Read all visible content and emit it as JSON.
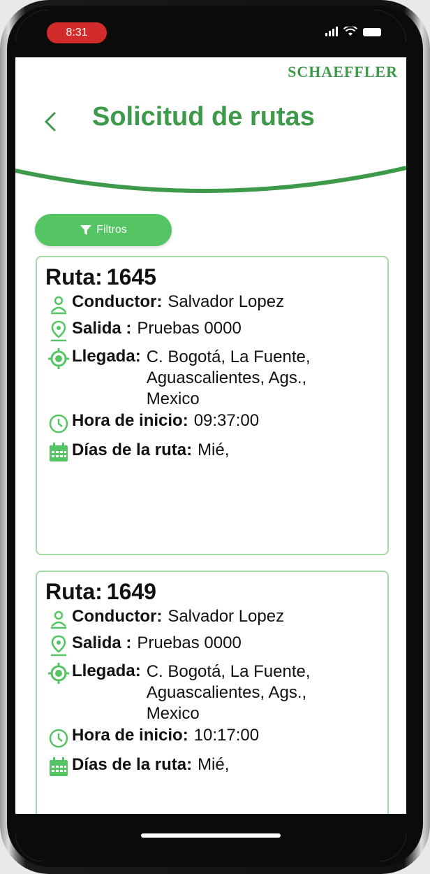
{
  "status_bar": {
    "time": "8:31"
  },
  "header": {
    "brand": "SCHAEFFLER",
    "title": "Solicitud de rutas",
    "back_icon": "chevron-left-icon"
  },
  "filter_button": {
    "label": "Filtros",
    "icon": "filter-icon"
  },
  "labels": {
    "route_prefix": "Ruta:",
    "driver": "Conductor:",
    "departure": "Salida :",
    "arrival": "Llegada:",
    "start_time": "Hora de inicio:",
    "days": "Días de la ruta:"
  },
  "routes": [
    {
      "number": "1645",
      "driver": "Salvador Lopez",
      "departure": "Pruebas 0000",
      "arrival": "C. Bogotá, La Fuente, Aguascalientes, Ags., Mexico",
      "start_time": "09:37:00",
      "days": "Mié,"
    },
    {
      "number": "1649",
      "driver": "Salvador Lopez",
      "departure": "Pruebas 0000",
      "arrival": "C. Bogotá, La Fuente, Aguascalientes, Ags., Mexico",
      "start_time": "10:17:00",
      "days": "Mié,"
    }
  ],
  "colors": {
    "accent": "#3d9a4a",
    "button": "#55c463",
    "card_border": "#9fdca8"
  }
}
